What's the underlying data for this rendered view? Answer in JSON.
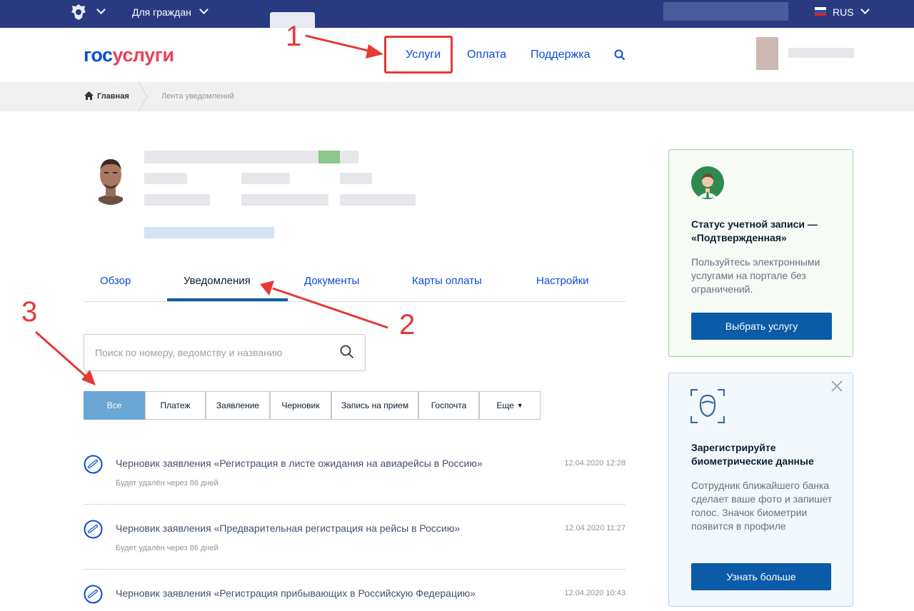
{
  "topbar": {
    "for_citizens": "Для граждан",
    "lang": "RUS"
  },
  "logo": {
    "part1": "гос",
    "part2": "услуги"
  },
  "nav": {
    "services": "Услуги",
    "payment": "Оплата",
    "support": "Поддержка"
  },
  "breadcrumb": {
    "home": "Главная",
    "current": "Лента уведомлений"
  },
  "tabs": [
    "Обзор",
    "Уведомления",
    "Документы",
    "Карты оплаты",
    "Настройки"
  ],
  "active_tab": "Уведомления",
  "search": {
    "placeholder": "Поиск по номеру, ведомству и названию"
  },
  "filters": [
    "Все",
    "Платеж",
    "Заявление",
    "Черновик",
    "Запись на прием",
    "Госпочта",
    "Еще"
  ],
  "active_filter": "Все",
  "notifications": [
    {
      "title": "Черновик заявления «Регистрация в листе ожидания на авиарейсы в Россию»",
      "subtitle": "Будет удалён через 86 дней",
      "date": "12.04.2020 12:28"
    },
    {
      "title": "Черновик заявления «Предварительная регистрация на рейсы в Россию»",
      "subtitle": "Будет удалён через 86 дней",
      "date": "12.04.2020 11:27"
    },
    {
      "title": "Черновик заявления «Регистрация прибывающих в Российскую Федерацию»",
      "subtitle": "",
      "date": "12.04.2020 10:43"
    }
  ],
  "status_card": {
    "title": "Статус учетной записи — «Подтвержденная»",
    "text": "Пользуйтесь электронными услугами на портале без ограничений.",
    "button": "Выбрать услугу"
  },
  "bio_card": {
    "title": "Зарегистрируйте биометрические данные",
    "text": "Сотрудник ближайшего банка сделает ваше фото и запишет голос. Значок биометрии появится в профиле",
    "button": "Узнать больше"
  },
  "annotations": {
    "n1": "1",
    "n2": "2",
    "n3": "3"
  },
  "colors": {
    "topbar": "#293a80",
    "accent": "#0d4cd3",
    "brand_red": "#ee3f58",
    "annotation": "#e53935",
    "button": "#0b5ba8"
  }
}
